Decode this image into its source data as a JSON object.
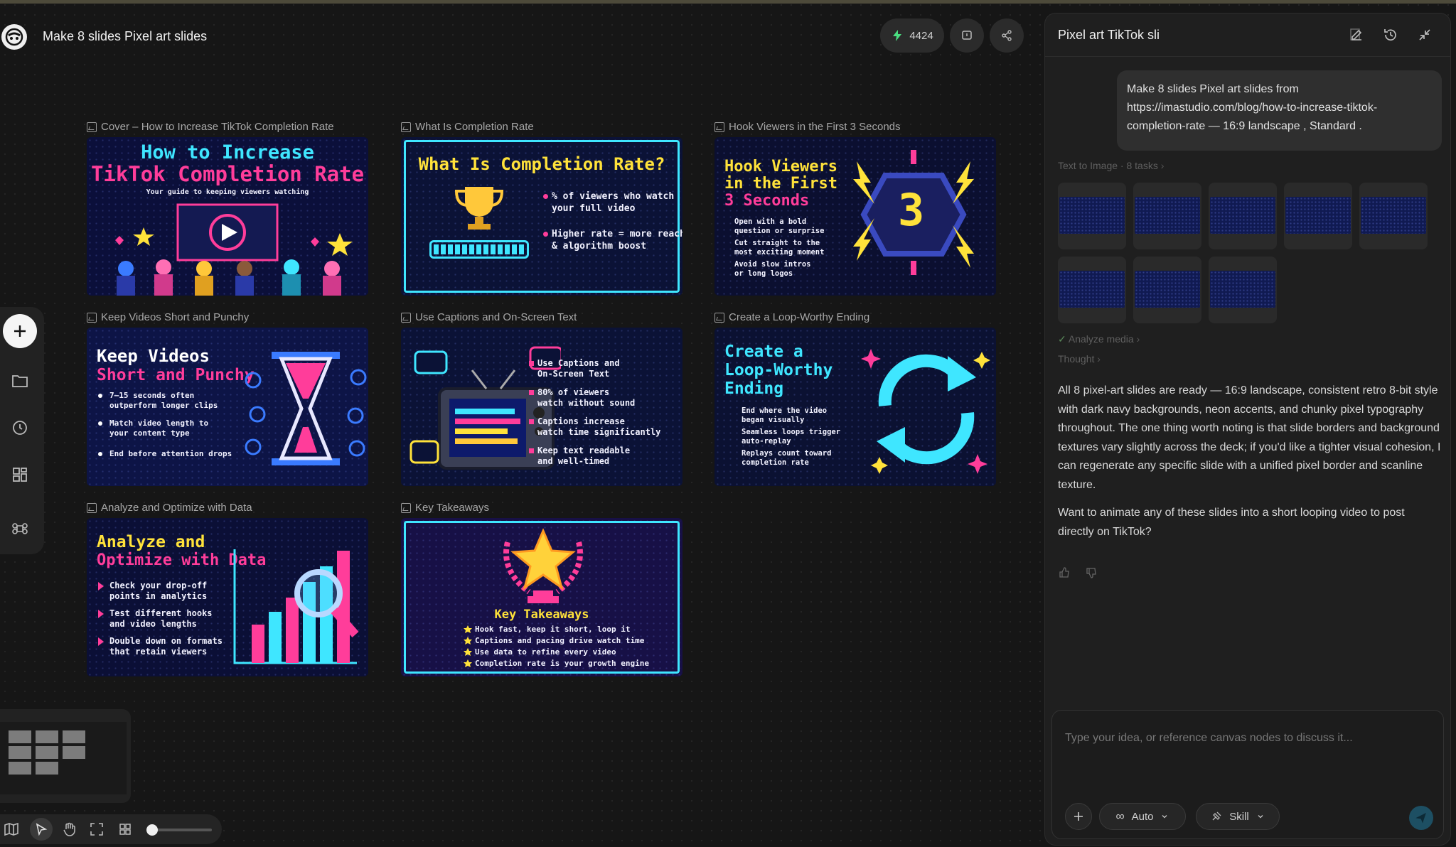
{
  "header": {
    "title": "Make 8 slides Pixel art slides",
    "credits": "4424"
  },
  "slides": [
    {
      "label": "Cover – How to Increase TikTok Completion Rate",
      "lines": [
        "How to Increase",
        "TikTok Completion Rate"
      ],
      "sub": "Your guide to keeping viewers watching"
    },
    {
      "label": "What Is Completion Rate",
      "heading": "What Is Completion Rate?",
      "bullets": [
        "% of viewers who watch",
        "your full video",
        "Higher rate = more reach",
        "& algorithm boost"
      ]
    },
    {
      "label": "Hook Viewers in the First 3 Seconds",
      "lines": [
        "Hook Viewers",
        "in the First",
        "3 Seconds"
      ],
      "bullets": [
        "Open with a bold",
        "question or surprise",
        "Cut straight to the",
        "most exciting moment",
        "Avoid slow intros",
        "or long logos"
      ],
      "big": "3"
    },
    {
      "label": "Keep Videos Short and Punchy",
      "lines": [
        "Keep Videos",
        "Short and Punchy"
      ],
      "bullets": [
        "7–15 seconds often",
        "outperform longer clips",
        "Match video length to",
        "your content type",
        "End before attention drops"
      ]
    },
    {
      "label": "Use Captions and On-Screen Text",
      "bullets": [
        "Use Captions and",
        "On-Screen Text",
        "80% of viewers",
        "watch without sound",
        "Captions increase",
        "watch time significantly",
        "Keep text readable",
        "and well-timed"
      ]
    },
    {
      "label": "Create a Loop-Worthy Ending",
      "lines": [
        "Create a",
        "Loop-Worthy",
        "Ending"
      ],
      "bullets": [
        "End where the video",
        "began visually",
        "Seamless loops trigger",
        "auto-replay",
        "Replays count toward",
        "completion rate"
      ]
    },
    {
      "label": "Analyze and Optimize with Data",
      "lines": [
        "Analyze and",
        "Optimize with Data"
      ],
      "bullets": [
        "Check your drop-off",
        "points in analytics",
        "Test different hooks",
        "and video lengths",
        "Double down on formats",
        "that retain viewers"
      ]
    },
    {
      "label": "Key Takeaways",
      "heading": "Key Takeaways",
      "bullets": [
        "Hook fast, keep it short, loop it",
        "Captions and pacing drive watch time",
        "Use data to refine every video",
        "Completion rate is your growth engine"
      ]
    }
  ],
  "panel": {
    "title": "Pixel art TikTok sli",
    "user_message": "Make 8 slides  Pixel art  slides from https://imastudio.com/blog/how-to-increase-tiktok-completion-rate  — 16:9 landscape , Standard .",
    "task_meta": "Text to Image · 8 tasks",
    "analyze": "Analyze media",
    "thought": "Thought",
    "reply1": "All 8 pixel-art slides are ready — 16:9 landscape, consistent retro 8-bit style with dark navy backgrounds, neon accents, and chunky pixel typography throughout. The one thing worth noting is that slide borders and background textures vary slightly across the deck; if you'd like a tighter visual cohesion, I can regenerate any specific slide with a unified pixel border and scanline texture.",
    "reply2": "Want to animate any of these slides into a short looping video to post directly on TikTok?",
    "input_placeholder": "Type your idea, or reference canvas nodes to discuss it...",
    "mode_label": "Auto",
    "skill_label": "Skill"
  },
  "colors": {
    "accent_cyan": "#3fe6ff",
    "accent_pink": "#ff3d9a",
    "accent_yellow": "#ffe23a",
    "slide_bg": "#0d1440"
  }
}
